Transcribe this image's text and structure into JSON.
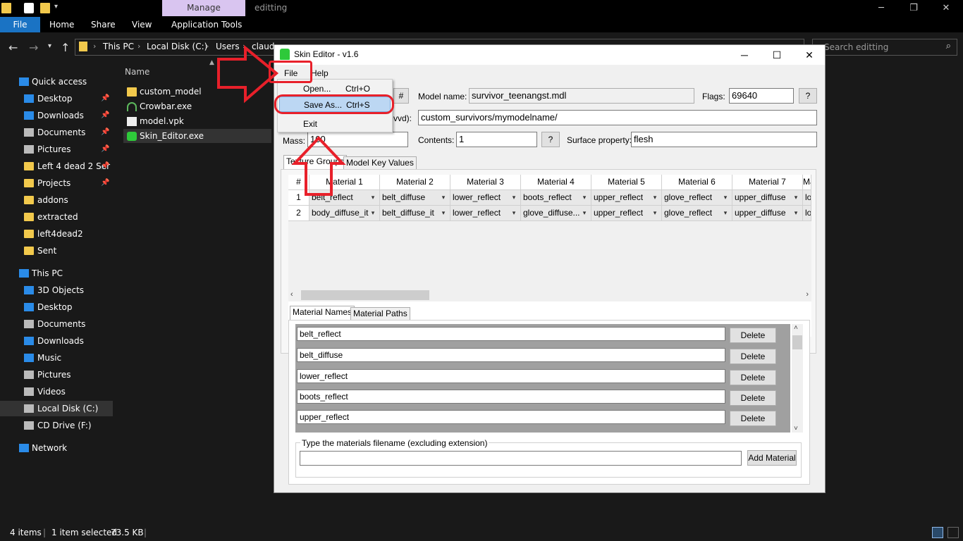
{
  "explorer": {
    "context_tab": "Manage",
    "window_title": "editting",
    "ribbon_tabs": [
      "File",
      "Home",
      "Share",
      "View",
      "Application Tools"
    ],
    "breadcrumbs": [
      "This PC",
      "Local Disk (C:)",
      "Users",
      "claud"
    ],
    "search_placeholder": "Search editting",
    "column_name": "Name",
    "nav_items": [
      {
        "label": "Quick access",
        "icon": "star-icon",
        "pinned": false
      },
      {
        "label": "Desktop",
        "icon": "desktop-icon",
        "pinned": true
      },
      {
        "label": "Downloads",
        "icon": "download-icon",
        "pinned": true
      },
      {
        "label": "Documents",
        "icon": "document-icon",
        "pinned": true
      },
      {
        "label": "Pictures",
        "icon": "picture-icon",
        "pinned": true
      },
      {
        "label": "Left 4 dead 2 Ser",
        "icon": "folder-icon",
        "pinned": true
      },
      {
        "label": "Projects",
        "icon": "folder-icon",
        "pinned": true
      },
      {
        "label": "addons",
        "icon": "folder-icon",
        "pinned": false
      },
      {
        "label": "extracted",
        "icon": "folder-icon",
        "pinned": false
      },
      {
        "label": "left4dead2",
        "icon": "folder-icon",
        "pinned": false
      },
      {
        "label": "Sent",
        "icon": "folder-icon",
        "pinned": false
      },
      {
        "label": "This PC",
        "icon": "pc-icon",
        "pinned": false
      },
      {
        "label": "3D Objects",
        "icon": "cube-icon",
        "pinned": false
      },
      {
        "label": "Desktop",
        "icon": "desktop-icon",
        "pinned": false
      },
      {
        "label": "Documents",
        "icon": "document-icon",
        "pinned": false
      },
      {
        "label": "Downloads",
        "icon": "download-icon",
        "pinned": false
      },
      {
        "label": "Music",
        "icon": "music-icon",
        "pinned": false
      },
      {
        "label": "Pictures",
        "icon": "picture-icon",
        "pinned": false
      },
      {
        "label": "Videos",
        "icon": "video-icon",
        "pinned": false
      },
      {
        "label": "Local Disk (C:)",
        "icon": "drive-icon",
        "pinned": false
      },
      {
        "label": "CD Drive (F:)",
        "icon": "cd-drive-icon",
        "pinned": false
      },
      {
        "label": "Network",
        "icon": "network-icon",
        "pinned": false
      }
    ],
    "files": [
      {
        "name": "custom_model",
        "icon": "folder-icon"
      },
      {
        "name": "Crowbar.exe",
        "icon": "crowbar-icon"
      },
      {
        "name": "model.vpk",
        "icon": "file-icon"
      },
      {
        "name": "Skin_Editor.exe",
        "icon": "skin-editor-icon"
      }
    ],
    "status": {
      "items": "4 items",
      "selected": "1 item selected",
      "size": "73.5 KB"
    }
  },
  "skin_editor": {
    "title": "Skin Editor - v1.6",
    "menu": [
      "File",
      "Help"
    ],
    "file_menu": [
      {
        "label": "Open...",
        "shortcut": "Ctrl+O"
      },
      {
        "label": "Save As...",
        "shortcut": "Ctrl+S"
      },
      {
        "label": "Exit",
        "shortcut": ""
      }
    ],
    "hash_label": "#",
    "model_name_label": "Model name:",
    "model_name_value": "survivor_teenangst.mdl",
    "flags_label": "Flags:",
    "flags_value": "69640",
    "question_label": "?",
    "path_label_fragment": "vvd):",
    "path_value": "custom_survivors/mymodelname/",
    "mass_label": "Mass:",
    "mass_value": "100",
    "contents_label": "Contents:",
    "contents_value": "1",
    "surface_label": "Surface property:",
    "surface_value": "flesh",
    "tabs_top": [
      "Texture Groups",
      "Model Key Values"
    ],
    "grid_headers": [
      "#",
      "Material 1",
      "Material 2",
      "Material 3",
      "Material 4",
      "Material 5",
      "Material 6",
      "Material 7",
      "Ma"
    ],
    "grid_rows": [
      [
        "1",
        "belt_reflect",
        "belt_diffuse",
        "lower_reflect",
        "boots_reflect",
        "upper_reflect",
        "glove_reflect",
        "upper_diffuse",
        "lo"
      ],
      [
        "2",
        "body_diffuse_it",
        "belt_diffuse_it",
        "lower_reflect",
        "glove_diffuse...",
        "upper_reflect",
        "glove_reflect",
        "upper_diffuse",
        "lo"
      ]
    ],
    "tabs_bottom": [
      "Material Names",
      "Material Paths"
    ],
    "materials": [
      "belt_reflect",
      "belt_diffuse",
      "lower_reflect",
      "boots_reflect",
      "upper_reflect"
    ],
    "delete_label": "Delete",
    "new_material_legend": "Type the materials filename (excluding extension)",
    "new_material_value": "",
    "add_material_label": "Add Material"
  }
}
